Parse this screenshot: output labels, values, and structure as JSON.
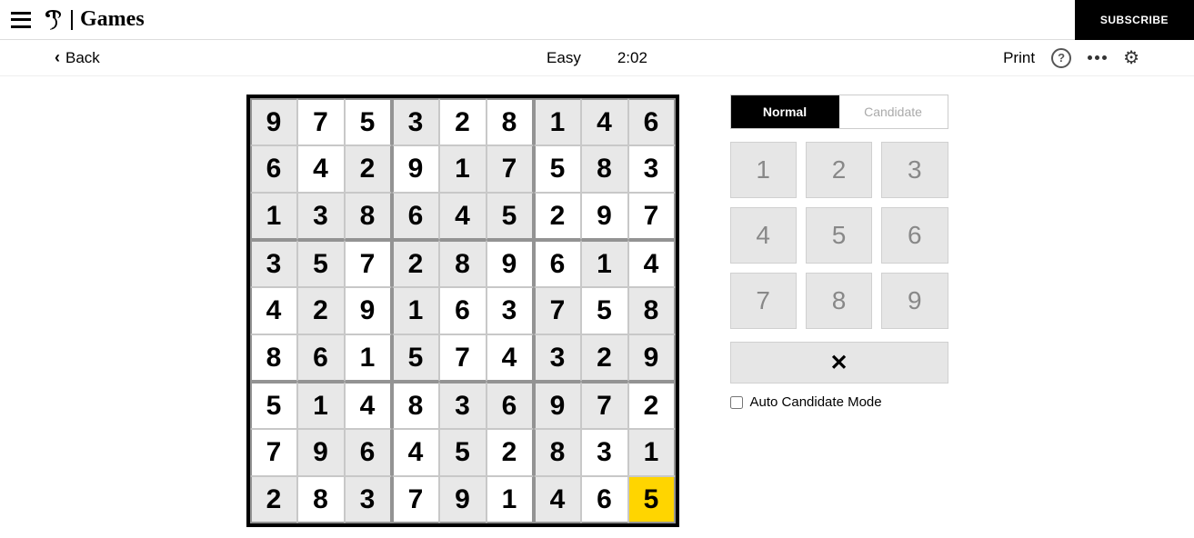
{
  "header": {
    "logo_games": "Games",
    "subscribe": "SUBSCRIBE"
  },
  "subheader": {
    "back": "Back",
    "difficulty": "Easy",
    "timer": "2:02",
    "print": "Print"
  },
  "board": {
    "cells": [
      [
        {
          "v": "9",
          "g": true
        },
        {
          "v": "7",
          "g": false
        },
        {
          "v": "5",
          "g": false
        },
        {
          "v": "3",
          "g": true
        },
        {
          "v": "2",
          "g": false
        },
        {
          "v": "8",
          "g": false
        },
        {
          "v": "1",
          "g": true
        },
        {
          "v": "4",
          "g": true
        },
        {
          "v": "6",
          "g": true
        }
      ],
      [
        {
          "v": "6",
          "g": true
        },
        {
          "v": "4",
          "g": false
        },
        {
          "v": "2",
          "g": true
        },
        {
          "v": "9",
          "g": false
        },
        {
          "v": "1",
          "g": true
        },
        {
          "v": "7",
          "g": true
        },
        {
          "v": "5",
          "g": false
        },
        {
          "v": "8",
          "g": true
        },
        {
          "v": "3",
          "g": false
        }
      ],
      [
        {
          "v": "1",
          "g": true
        },
        {
          "v": "3",
          "g": true
        },
        {
          "v": "8",
          "g": true
        },
        {
          "v": "6",
          "g": true
        },
        {
          "v": "4",
          "g": true
        },
        {
          "v": "5",
          "g": true
        },
        {
          "v": "2",
          "g": false
        },
        {
          "v": "9",
          "g": false
        },
        {
          "v": "7",
          "g": false
        }
      ],
      [
        {
          "v": "3",
          "g": true
        },
        {
          "v": "5",
          "g": true
        },
        {
          "v": "7",
          "g": false
        },
        {
          "v": "2",
          "g": true
        },
        {
          "v": "8",
          "g": true
        },
        {
          "v": "9",
          "g": false
        },
        {
          "v": "6",
          "g": false
        },
        {
          "v": "1",
          "g": true
        },
        {
          "v": "4",
          "g": false
        }
      ],
      [
        {
          "v": "4",
          "g": false
        },
        {
          "v": "2",
          "g": true
        },
        {
          "v": "9",
          "g": false
        },
        {
          "v": "1",
          "g": true
        },
        {
          "v": "6",
          "g": false
        },
        {
          "v": "3",
          "g": false
        },
        {
          "v": "7",
          "g": true
        },
        {
          "v": "5",
          "g": false
        },
        {
          "v": "8",
          "g": true
        }
      ],
      [
        {
          "v": "8",
          "g": false
        },
        {
          "v": "6",
          "g": true
        },
        {
          "v": "1",
          "g": false
        },
        {
          "v": "5",
          "g": true
        },
        {
          "v": "7",
          "g": false
        },
        {
          "v": "4",
          "g": false
        },
        {
          "v": "3",
          "g": true
        },
        {
          "v": "2",
          "g": true
        },
        {
          "v": "9",
          "g": true
        }
      ],
      [
        {
          "v": "5",
          "g": false
        },
        {
          "v": "1",
          "g": true
        },
        {
          "v": "4",
          "g": false
        },
        {
          "v": "8",
          "g": false
        },
        {
          "v": "3",
          "g": true
        },
        {
          "v": "6",
          "g": true
        },
        {
          "v": "9",
          "g": true
        },
        {
          "v": "7",
          "g": true
        },
        {
          "v": "2",
          "g": false
        }
      ],
      [
        {
          "v": "7",
          "g": false
        },
        {
          "v": "9",
          "g": true
        },
        {
          "v": "6",
          "g": true
        },
        {
          "v": "4",
          "g": false
        },
        {
          "v": "5",
          "g": true
        },
        {
          "v": "2",
          "g": false
        },
        {
          "v": "8",
          "g": true
        },
        {
          "v": "3",
          "g": false
        },
        {
          "v": "1",
          "g": true
        }
      ],
      [
        {
          "v": "2",
          "g": true
        },
        {
          "v": "8",
          "g": false
        },
        {
          "v": "3",
          "g": true
        },
        {
          "v": "7",
          "g": false
        },
        {
          "v": "9",
          "g": true
        },
        {
          "v": "1",
          "g": false
        },
        {
          "v": "4",
          "g": true
        },
        {
          "v": "6",
          "g": false
        },
        {
          "v": "5",
          "g": false,
          "sel": true
        }
      ]
    ]
  },
  "controls": {
    "mode_normal": "Normal",
    "mode_candidate": "Candidate",
    "keys": [
      "1",
      "2",
      "3",
      "4",
      "5",
      "6",
      "7",
      "8",
      "9"
    ],
    "delete_icon": "✕",
    "auto_candidate": "Auto Candidate Mode"
  }
}
